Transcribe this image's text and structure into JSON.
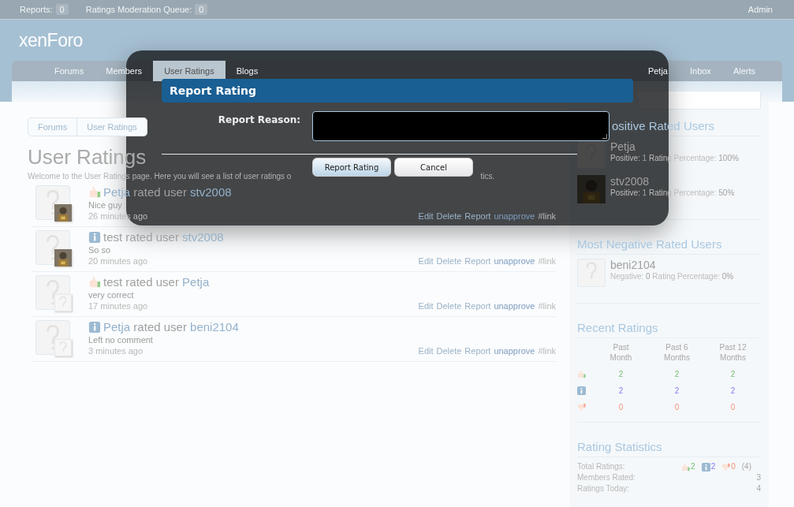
{
  "top_bar": {
    "items": [
      {
        "label": "Reports:",
        "count": "0"
      },
      {
        "label": "Ratings Moderation Queue:",
        "count": "0"
      }
    ],
    "user": "Admin"
  },
  "logo": {
    "light": "xen",
    "bold": "Foro"
  },
  "nav": {
    "tabs": [
      {
        "label": "Forums",
        "selected": false
      },
      {
        "label": "Members",
        "selected": false
      },
      {
        "label": "User Ratings",
        "selected": true
      },
      {
        "label": "Blogs",
        "selected": false
      }
    ],
    "user_links": [
      "Petja",
      "Inbox",
      "Alerts"
    ]
  },
  "breadcrumb": [
    "Forums",
    "User Ratings"
  ],
  "page_title": "User Ratings",
  "intro": [
    "Welcome to the User Ratings page. Here you will see a list of user ratings o",
    "tics."
  ],
  "ratings": [
    {
      "kind": "like",
      "rater": "Petja",
      "rater_link": true,
      "verb": "rated user",
      "target": "stv2008",
      "comment": "Nice guy",
      "time": "26 minutes ago",
      "target_has_photo": true,
      "actions": [
        "Edit",
        "Delete",
        "Report",
        "unapprove",
        "#link"
      ]
    },
    {
      "kind": "neutral",
      "rater": "test",
      "rater_link": false,
      "verb": "rated user",
      "target": "stv2008",
      "comment": "So so",
      "time": "20 minutes ago",
      "target_has_photo": true,
      "actions": [
        "Edit",
        "Delete",
        "Report",
        "unapprove",
        "#link"
      ]
    },
    {
      "kind": "like",
      "rater": "test",
      "rater_link": false,
      "verb": "rated user",
      "target": "Petja",
      "comment": "very correct",
      "time": "17 minutes ago",
      "target_has_photo": false,
      "actions": [
        "Edit",
        "Delete",
        "Report",
        "unapprove",
        "#link"
      ]
    },
    {
      "kind": "neutral",
      "rater": "Petja",
      "rater_link": true,
      "verb": "rated user",
      "target": "beni2104",
      "comment": "Left no comment",
      "time": "3 minutes ago",
      "target_has_photo": false,
      "actions": [
        "Edit",
        "Delete",
        "Report",
        "unapprove",
        "#link"
      ]
    }
  ],
  "sidebar": {
    "user_lists": [
      {
        "title": "ositive Rated Users",
        "users": [
          {
            "name": "Petja",
            "has_photo": false,
            "stat_label": "Positive:",
            "count": "1",
            "pct_label": "Rating Percentage:",
            "pct": "100%"
          },
          {
            "name": "stv2008",
            "has_photo": true,
            "stat_label": "Positive:",
            "count": "1",
            "pct_label": "Rating Percentage:",
            "pct": "50%"
          }
        ]
      },
      {
        "title": "Most Negative Rated Users",
        "users": [
          {
            "name": "beni2104",
            "has_photo": false,
            "stat_label": "Negative:",
            "count": "0",
            "pct_label": "Rating Percentage:",
            "pct": "0%"
          }
        ]
      }
    ],
    "recent": {
      "title": "Recent Ratings",
      "columns": [
        "Past Month",
        "Past 6 Months",
        "Past 12 Months"
      ],
      "rows": [
        {
          "kind": "like",
          "values": [
            "2",
            "2",
            "2"
          ]
        },
        {
          "kind": "neutral",
          "values": [
            "2",
            "2",
            "2"
          ]
        },
        {
          "kind": "dislike",
          "values": [
            "0",
            "0",
            "0"
          ]
        }
      ]
    },
    "stats": {
      "title": "Rating Statistics",
      "total_label": "Total Ratings:",
      "totals": [
        {
          "kind": "like",
          "value": "2"
        },
        {
          "kind": "neutral",
          "value": "2"
        },
        {
          "kind": "dislike",
          "value": "0"
        }
      ],
      "total_sum": "(4)",
      "rows": [
        {
          "label": "Members Rated:",
          "value": "3"
        },
        {
          "label": "Ratings Today:",
          "value": "4"
        }
      ]
    }
  },
  "modal": {
    "title": "Report Rating",
    "field_label": "Report Reason:",
    "buttons": [
      {
        "label": "Report Rating",
        "primary": true
      },
      {
        "label": "Cancel",
        "primary": false
      }
    ]
  }
}
